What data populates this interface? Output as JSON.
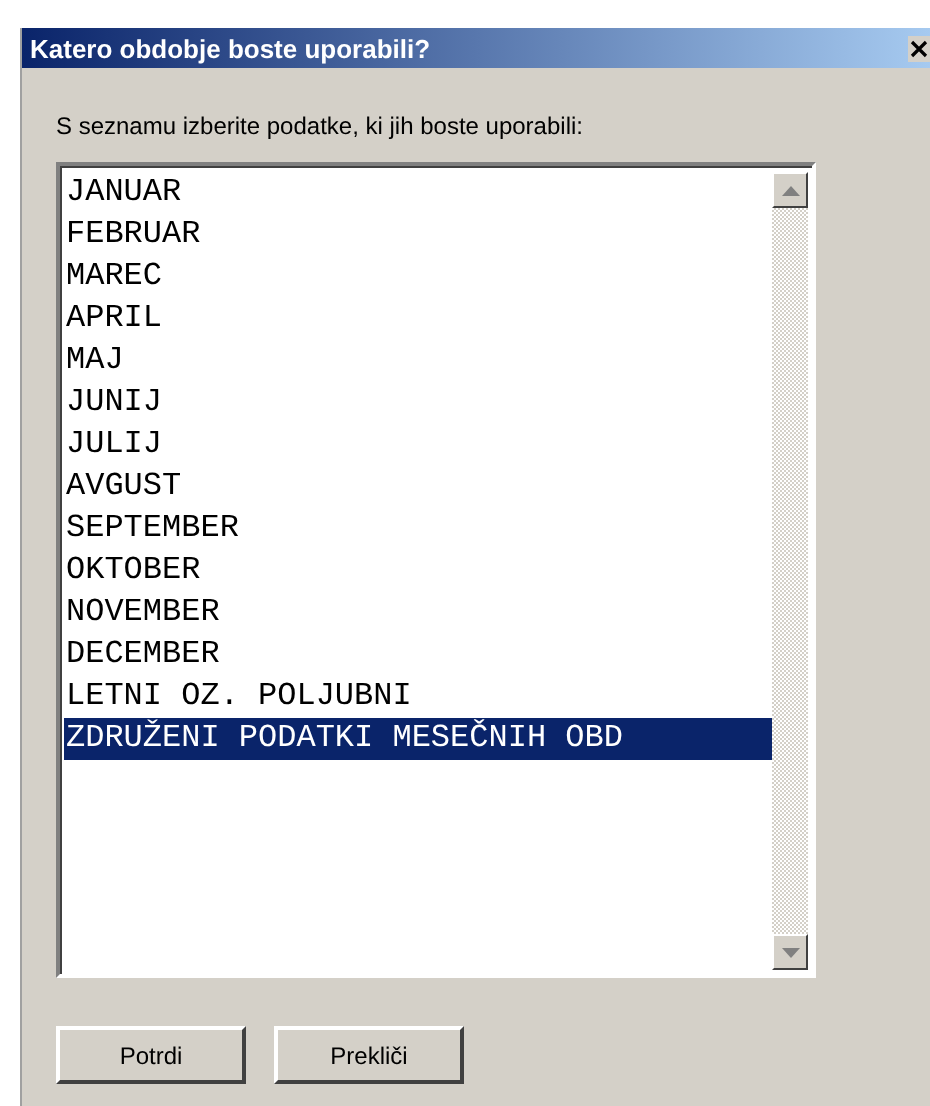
{
  "window": {
    "title": "Katero obdobje boste uporabili?"
  },
  "prompt": "S seznamu izberite podatke, ki jih boste uporabili:",
  "list": {
    "items": [
      {
        "label": "JANUAR",
        "selected": false
      },
      {
        "label": "FEBRUAR",
        "selected": false
      },
      {
        "label": "MAREC",
        "selected": false
      },
      {
        "label": "APRIL",
        "selected": false
      },
      {
        "label": "MAJ",
        "selected": false
      },
      {
        "label": "JUNIJ",
        "selected": false
      },
      {
        "label": "JULIJ",
        "selected": false
      },
      {
        "label": "AVGUST",
        "selected": false
      },
      {
        "label": "SEPTEMBER",
        "selected": false
      },
      {
        "label": "OKTOBER",
        "selected": false
      },
      {
        "label": "NOVEMBER",
        "selected": false
      },
      {
        "label": "DECEMBER",
        "selected": false
      },
      {
        "label": "LETNI OZ. POLJUBNI",
        "selected": false
      },
      {
        "label": "ZDRUŽENI PODATKI MESEČNIH OBD",
        "selected": true
      }
    ]
  },
  "buttons": [
    "Potrdi",
    "Prekliči"
  ]
}
